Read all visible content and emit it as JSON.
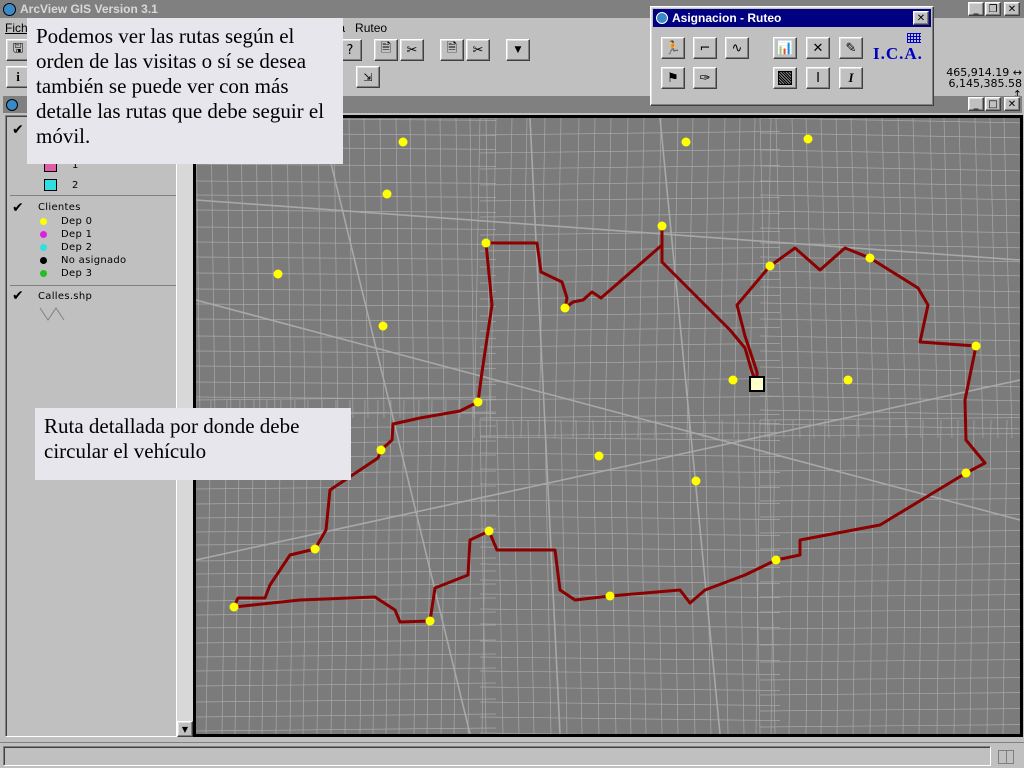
{
  "app": {
    "title": "ArcView GIS Version 3.1",
    "menu": [
      "Fich",
      "da",
      "Ruteo"
    ]
  },
  "coords": {
    "x": "465,914.19",
    "y": "6,145,385.58"
  },
  "dialog": {
    "title": "Asignacion - Ruteo",
    "logo": "I.C.A."
  },
  "legend": {
    "items_top": [
      {
        "label": "1",
        "color": "#e05ca8"
      },
      {
        "label": "2",
        "color": "#30e0e0"
      }
    ],
    "clientes_title": "Clientes",
    "clientes": [
      {
        "label": "Dep 0",
        "color": "#ffff00"
      },
      {
        "label": "Dep 1",
        "color": "#e020e0"
      },
      {
        "label": "Dep 2",
        "color": "#30e0e0"
      },
      {
        "label": "No asignado",
        "color": "#000000"
      },
      {
        "label": "Dep 3",
        "color": "#20c020"
      }
    ],
    "calles_title": "Calles.shp"
  },
  "callouts": {
    "top": "Podemos ver las rutas según el orden de las visitas o sí se desea también se puede ver con más detalle las rutas que debe seguir el móvil.",
    "bottom": "Ruta detallada por donde debe circular el vehículo"
  },
  "colors": {
    "map_bg": "#7b7b7b",
    "street": "#a8a8a8",
    "route": "#8b0000",
    "client": "#ffff00"
  },
  "map_points": [
    [
      403,
      142
    ],
    [
      686,
      142
    ],
    [
      808,
      139
    ],
    [
      387,
      194
    ],
    [
      662,
      226
    ],
    [
      486,
      243
    ],
    [
      770,
      266
    ],
    [
      870,
      258
    ],
    [
      278,
      274
    ],
    [
      565,
      308
    ],
    [
      383,
      326
    ],
    [
      976,
      346
    ],
    [
      733,
      380
    ],
    [
      848,
      380
    ],
    [
      478,
      402
    ],
    [
      381,
      450
    ],
    [
      599,
      456
    ],
    [
      696,
      481
    ],
    [
      966,
      473
    ],
    [
      489,
      531
    ],
    [
      315,
      549
    ],
    [
      776,
      560
    ],
    [
      610,
      596
    ],
    [
      234,
      607
    ],
    [
      430,
      621
    ]
  ],
  "route": [
    [
      486,
      243
    ],
    [
      537,
      243
    ],
    [
      541,
      272
    ],
    [
      562,
      282
    ],
    [
      567,
      298
    ],
    [
      565,
      308
    ],
    [
      573,
      302
    ],
    [
      583,
      300
    ],
    [
      592,
      292
    ],
    [
      601,
      298
    ],
    [
      662,
      245
    ],
    [
      662,
      226
    ],
    [
      662,
      262
    ],
    [
      730,
      330
    ],
    [
      745,
      348
    ],
    [
      752,
      372
    ],
    [
      757,
      384
    ],
    [
      757,
      372
    ],
    [
      745,
      336
    ],
    [
      737,
      305
    ],
    [
      770,
      266
    ],
    [
      795,
      248
    ],
    [
      820,
      270
    ],
    [
      845,
      248
    ],
    [
      870,
      258
    ],
    [
      918,
      288
    ],
    [
      928,
      305
    ],
    [
      920,
      342
    ],
    [
      976,
      346
    ],
    [
      965,
      400
    ],
    [
      966,
      440
    ],
    [
      985,
      463
    ],
    [
      966,
      473
    ],
    [
      880,
      525
    ],
    [
      800,
      540
    ],
    [
      800,
      555
    ],
    [
      776,
      560
    ],
    [
      745,
      575
    ],
    [
      705,
      590
    ],
    [
      690,
      603
    ],
    [
      680,
      590
    ],
    [
      610,
      596
    ],
    [
      575,
      600
    ],
    [
      560,
      590
    ],
    [
      555,
      550
    ],
    [
      497,
      550
    ],
    [
      489,
      531
    ],
    [
      470,
      540
    ],
    [
      468,
      575
    ],
    [
      435,
      588
    ],
    [
      430,
      621
    ],
    [
      400,
      622
    ],
    [
      395,
      610
    ],
    [
      375,
      597
    ],
    [
      300,
      600
    ],
    [
      234,
      607
    ],
    [
      238,
      598
    ],
    [
      265,
      598
    ],
    [
      270,
      585
    ],
    [
      290,
      555
    ],
    [
      315,
      549
    ],
    [
      326,
      530
    ],
    [
      330,
      490
    ],
    [
      378,
      458
    ],
    [
      381,
      450
    ],
    [
      392,
      440
    ],
    [
      393,
      424
    ],
    [
      420,
      418
    ],
    [
      460,
      411
    ],
    [
      478,
      402
    ],
    [
      482,
      372
    ],
    [
      492,
      305
    ],
    [
      486,
      243
    ]
  ],
  "depot": [
    757,
    384
  ]
}
